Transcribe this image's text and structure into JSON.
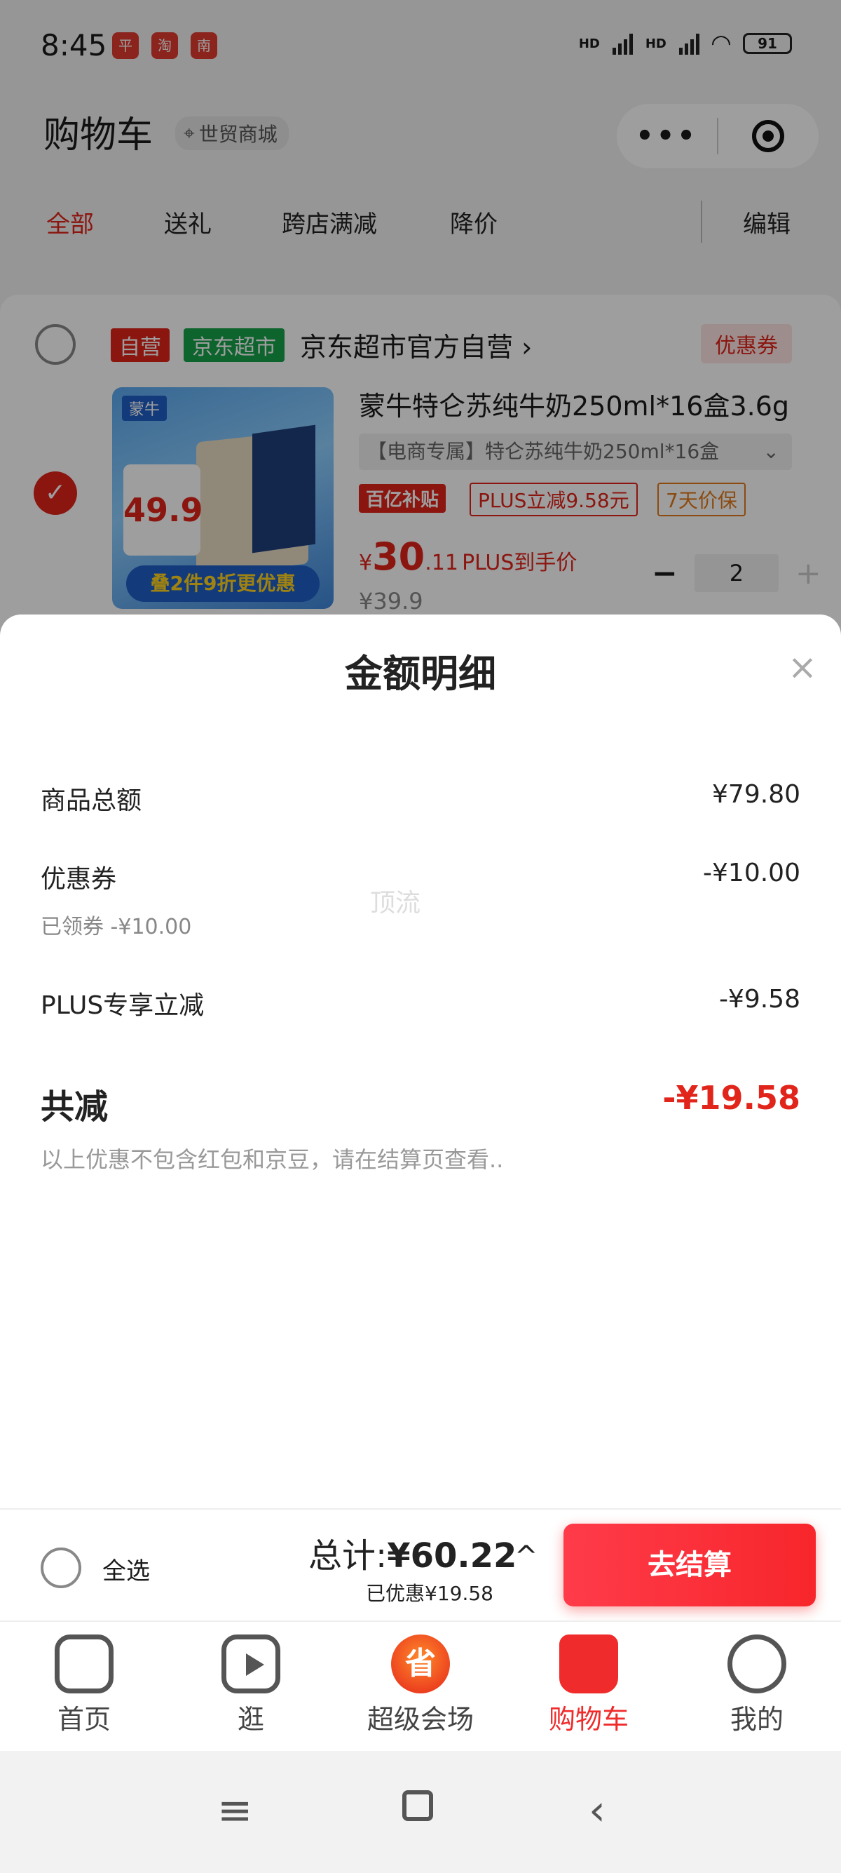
{
  "status_bar": {
    "time": "8:45",
    "apps": [
      "平",
      "淘",
      "南"
    ],
    "network_1": "HD",
    "network_2": "HD",
    "battery": "91"
  },
  "header": {
    "title": "购物车",
    "location": "世贸商城",
    "more_glyph": "•••"
  },
  "tabs": [
    {
      "label": "全部",
      "active": true
    },
    {
      "label": "送礼",
      "active": false
    },
    {
      "label": "跨店满减",
      "active": false
    },
    {
      "label": "降价",
      "active": false
    },
    {
      "label": "编辑",
      "active": false
    }
  ],
  "store": {
    "tag_self": "自营",
    "tag_market": "京东超市",
    "name": "京东超市官方自营",
    "arrow": "›",
    "coupon": "优惠券"
  },
  "product": {
    "title": "蒙牛特仑苏纯牛奶250ml*16盒3.6g",
    "spec": "【电商专属】特仑苏纯牛奶250ml*16盒",
    "spec_arrow": "⌄",
    "badge_subsidy": "百亿补贴",
    "badge_plus": "PLUS立减9.58元",
    "badge_protect": "7天价保",
    "price_symbol": "¥",
    "price_int": "30",
    "price_dec": ".11",
    "price_note": "PLUS到手价",
    "original_price": "¥39.9",
    "quantity": "2",
    "minus": "−",
    "plus": "+",
    "image_brand": "蒙牛",
    "image_sale": "49.9",
    "image_banner": "叠2件9折更优惠"
  },
  "sheet": {
    "title": "金额明细",
    "close": "×",
    "rows": [
      {
        "label": "商品总额",
        "value": "¥79.80"
      },
      {
        "label": "优惠券",
        "value": "-¥10.00",
        "sub": "已领券 -¥10.00"
      },
      {
        "label": "PLUS专享立减",
        "value": "-¥9.58"
      }
    ],
    "watermark": "顶流",
    "total_label": "共减",
    "total_value": "-¥19.58",
    "note": "以上优惠不包含红包和京豆，请在结算页查看.."
  },
  "checkout": {
    "select_all": "全选",
    "total_prefix": "总计:",
    "total_amount": "¥60.22",
    "saved": "已优惠¥19.58",
    "chevron": "^",
    "button": "去结算"
  },
  "tabbar": [
    {
      "label": "首页",
      "icon": "home-icon"
    },
    {
      "label": "逛",
      "icon": "play-icon"
    },
    {
      "label": "超级会场",
      "icon": "super-venue-icon",
      "glyph": "省"
    },
    {
      "label": "购物车",
      "icon": "cart-icon",
      "active": true
    },
    {
      "label": "我的",
      "icon": "profile-icon"
    }
  ],
  "sysnav": {
    "menu": "≡",
    "back": "‹"
  },
  "colors": {
    "accent": "#e1251b",
    "green": "#16a24a"
  }
}
